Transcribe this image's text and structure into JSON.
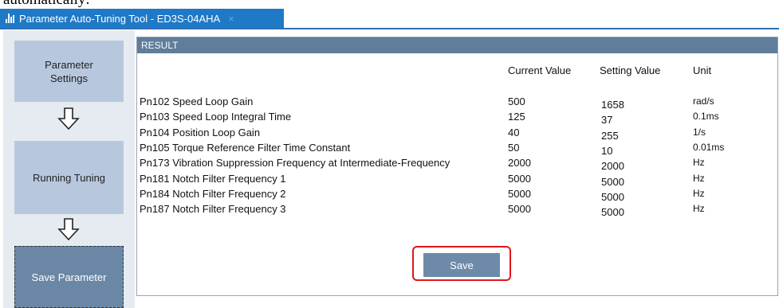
{
  "caption": "automatically:",
  "window": {
    "tab_title": "Parameter Auto-Tuning Tool - ED3S-04AHA",
    "close_glyph": "×"
  },
  "sidebar": {
    "steps": [
      {
        "label": "Parameter\nSettings"
      },
      {
        "label": "Running Tuning"
      },
      {
        "label": "Save Parameter"
      }
    ],
    "active_step": 2
  },
  "result": {
    "title": "RESULT",
    "columns": {
      "current": "Current Value",
      "setting": "Setting Value",
      "unit": "Unit"
    },
    "rows": [
      {
        "name": "Pn102 Speed Loop Gain",
        "current": "500",
        "setting": "1658",
        "unit": "rad/s"
      },
      {
        "name": "Pn103 Speed Loop Integral Time",
        "current": "125",
        "setting": "37",
        "unit": "0.1ms"
      },
      {
        "name": "Pn104 Position Loop Gain",
        "current": "40",
        "setting": "255",
        "unit": "1/s"
      },
      {
        "name": "Pn105 Torque Reference Filter Time Constant",
        "current": "50",
        "setting": "10",
        "unit": "0.01ms"
      },
      {
        "name": "Pn173 Vibration Suppression Frequency at Intermediate-Frequency",
        "current": "2000",
        "setting": "2000",
        "unit": "Hz"
      },
      {
        "name": "Pn181 Notch Filter Frequency 1",
        "current": "5000",
        "setting": "5000",
        "unit": "Hz"
      },
      {
        "name": "Pn184 Notch Filter Frequency 2",
        "current": "5000",
        "setting": "5000",
        "unit": "Hz"
      },
      {
        "name": "Pn187 Notch Filter Frequency 3",
        "current": "5000",
        "setting": "5000",
        "unit": "Hz"
      }
    ],
    "save_label": "Save"
  },
  "colors": {
    "tab_bg": "#1e7ac6",
    "header_bg": "#607d9a",
    "step_inactive": "#b7c8de",
    "step_active": "#6b87a6",
    "highlight": "#e0161b"
  }
}
